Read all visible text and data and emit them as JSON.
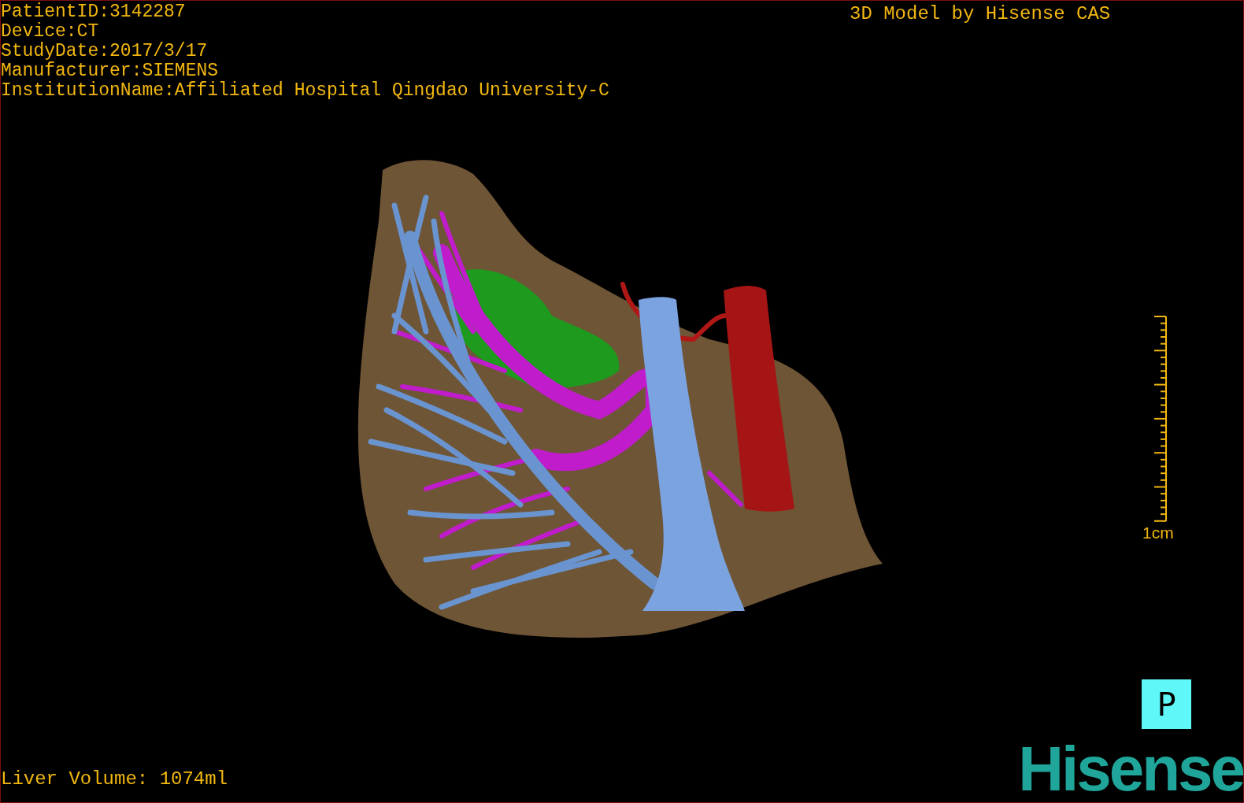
{
  "info_lines": [
    "PatientID:3142287",
    "Device:CT",
    "StudyDate:2017/3/17",
    "Manufacturer:SIEMENS",
    "InstitutionName:Affiliated Hospital Qingdao University-C"
  ],
  "title": "3D Model by Hisense CAS",
  "scale_bar": {
    "label": "1cm"
  },
  "orientation": "P",
  "logo": "Hisense",
  "footer": "Liver Volume: 1074ml"
}
